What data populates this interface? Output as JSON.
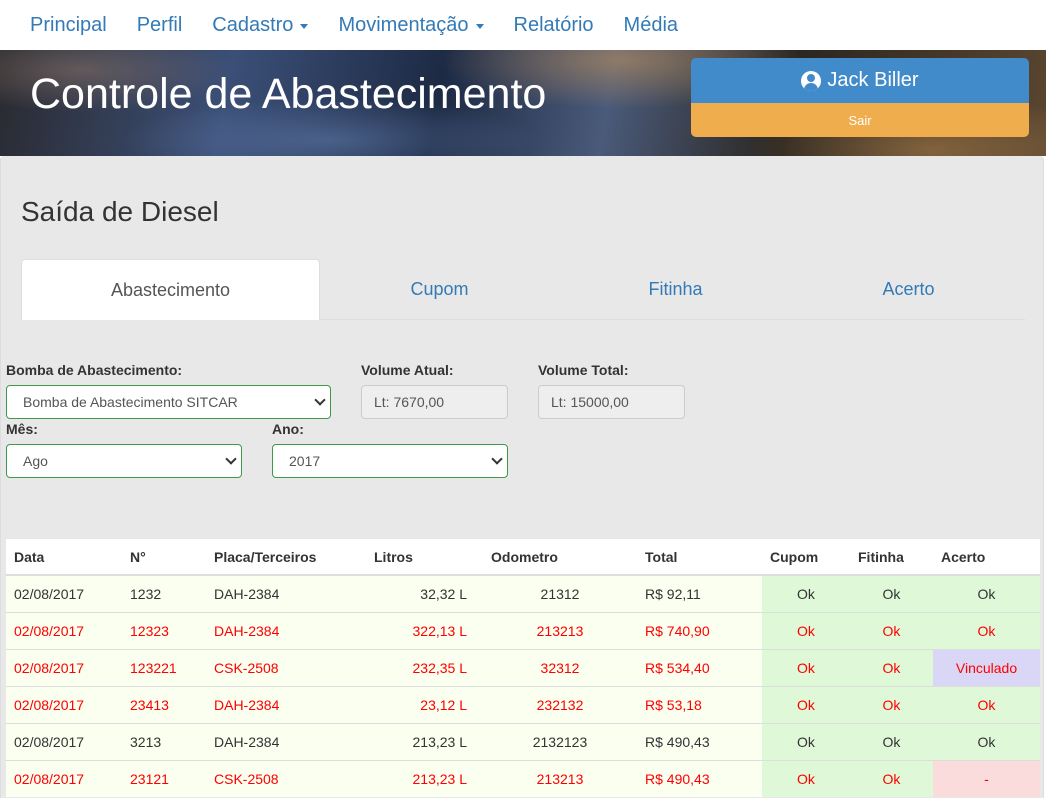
{
  "nav": {
    "items": [
      {
        "label": "Principal",
        "dropdown": false
      },
      {
        "label": "Perfil",
        "dropdown": false
      },
      {
        "label": "Cadastro",
        "dropdown": true
      },
      {
        "label": "Movimentação",
        "dropdown": true
      },
      {
        "label": "Relatório",
        "dropdown": false
      },
      {
        "label": "Média",
        "dropdown": false
      }
    ]
  },
  "header": {
    "title": "Controle de Abastecimento",
    "user_name": "Jack Biller",
    "logout_label": "Sair"
  },
  "page": {
    "title": "Saída de Diesel",
    "tabs": [
      "Abastecimento",
      "Cupom",
      "Fitinha",
      "Acerto"
    ],
    "active_tab": "Abastecimento"
  },
  "form": {
    "pump_label": "Bomba de Abastecimento:",
    "pump_value": "Bomba de Abastecimento SITCAR",
    "current_volume_label": "Volume Atual:",
    "current_volume_value": "Lt: 7670,00",
    "total_volume_label": "Volume Total:",
    "total_volume_value": "Lt: 15000,00",
    "month_label": "Mês:",
    "month_value": "Ago",
    "year_label": "Ano:",
    "year_value": "2017"
  },
  "table": {
    "headers": [
      "Data",
      "N°",
      "Placa/Terceiros",
      "Litros",
      "Odometro",
      "Total",
      "Cupom",
      "Fitinha",
      "Acerto"
    ],
    "rows": [
      {
        "data": "02/08/2017",
        "n": "1232",
        "placa": "DAH-2384",
        "litros": "32,32 L",
        "odometro": "21312",
        "total": "R$ 92,11",
        "cupom": "Ok",
        "fitinha": "Ok",
        "acerto": "Ok",
        "alert": false,
        "acerto_state": "ok"
      },
      {
        "data": "02/08/2017",
        "n": "12323",
        "placa": "DAH-2384",
        "litros": "322,13 L",
        "odometro": "213213",
        "total": "R$ 740,90",
        "cupom": "Ok",
        "fitinha": "Ok",
        "acerto": "Ok",
        "alert": true,
        "acerto_state": "ok"
      },
      {
        "data": "02/08/2017",
        "n": "123221",
        "placa": "CSK-2508",
        "litros": "232,35 L",
        "odometro": "32312",
        "total": "R$ 534,40",
        "cupom": "Ok",
        "fitinha": "Ok",
        "acerto": "Vinculado",
        "alert": true,
        "acerto_state": "vinc"
      },
      {
        "data": "02/08/2017",
        "n": "23413",
        "placa": "DAH-2384",
        "litros": "23,12 L",
        "odometro": "232132",
        "total": "R$ 53,18",
        "cupom": "Ok",
        "fitinha": "Ok",
        "acerto": "Ok",
        "alert": true,
        "acerto_state": "ok"
      },
      {
        "data": "02/08/2017",
        "n": "3213",
        "placa": "DAH-2384",
        "litros": "213,23 L",
        "odometro": "2132123",
        "total": "R$ 490,43",
        "cupom": "Ok",
        "fitinha": "Ok",
        "acerto": "Ok",
        "alert": false,
        "acerto_state": "ok"
      },
      {
        "data": "02/08/2017",
        "n": "23121",
        "placa": "CSK-2508",
        "litros": "213,23 L",
        "odometro": "213213",
        "total": "R$ 490,43",
        "cupom": "Ok",
        "fitinha": "Ok",
        "acerto": "-",
        "alert": true,
        "acerto_state": "dash"
      }
    ]
  },
  "colors": {
    "link": "#337ab7",
    "user_button": "#428bca",
    "logout_button": "#f0ad4e",
    "alert_text": "#ff0000",
    "ok_cell": "#dff8d8",
    "vinculado_cell": "#d9d7f5",
    "dash_cell": "#fbdcdc",
    "row_bg": "#fafff0"
  },
  "icons": {
    "user": "user-circle-icon"
  }
}
